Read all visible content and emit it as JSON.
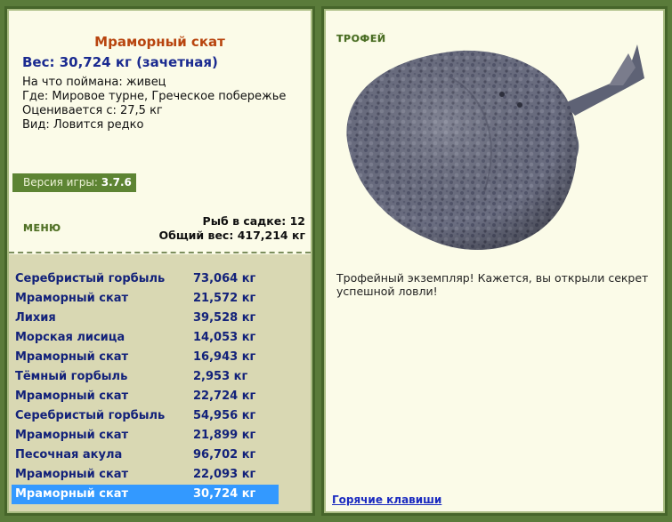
{
  "catch": {
    "name": "Мраморный скат",
    "weight_line": "Вес: 30,724 кг (зачетная)",
    "bait_line": "На что поймана: живец",
    "where_line": "Где: Мировое турне, Греческое побережье",
    "valued_line": "Оценивается с: 27,5 кг",
    "kind_line": "Вид: Ловится редко"
  },
  "version": {
    "label": "Версия игры:",
    "value": "3.7.6"
  },
  "menu_label": "МЕНЮ",
  "stats": {
    "count_line": "Рыб в садке: 12",
    "total_line": "Общий вес: 417,214 кг"
  },
  "fish_list": [
    {
      "name": "Серебристый горбыль",
      "weight": "73,064 кг"
    },
    {
      "name": "Мраморный скат",
      "weight": "21,572 кг"
    },
    {
      "name": "Лихия",
      "weight": "39,528 кг"
    },
    {
      "name": "Морская лисица",
      "weight": "14,053 кг"
    },
    {
      "name": "Мраморный скат",
      "weight": "16,943 кг"
    },
    {
      "name": "Тёмный горбыль",
      "weight": "2,953 кг"
    },
    {
      "name": "Мраморный скат",
      "weight": "22,724 кг"
    },
    {
      "name": "Серебристый горбыль",
      "weight": "54,956 кг"
    },
    {
      "name": "Мраморный скат",
      "weight": "21,899 кг"
    },
    {
      "name": "Песочная акула",
      "weight": "96,702 кг"
    },
    {
      "name": "Мраморный скат",
      "weight": "22,093 кг"
    },
    {
      "name": "Мраморный скат",
      "weight": "30,724 кг"
    }
  ],
  "selected_index": 11,
  "colors": {
    "selected_row": "#3399ff",
    "title": "#b8450f",
    "link": "#1a2ac0"
  },
  "trophy": {
    "label": "ТРОФЕЙ",
    "image": "marbled-ray-fish",
    "description": "Трофейный экземпляр! Кажется, вы открыли секрет успешной ловли!"
  },
  "hotkeys_label": "Горячие клавиши"
}
